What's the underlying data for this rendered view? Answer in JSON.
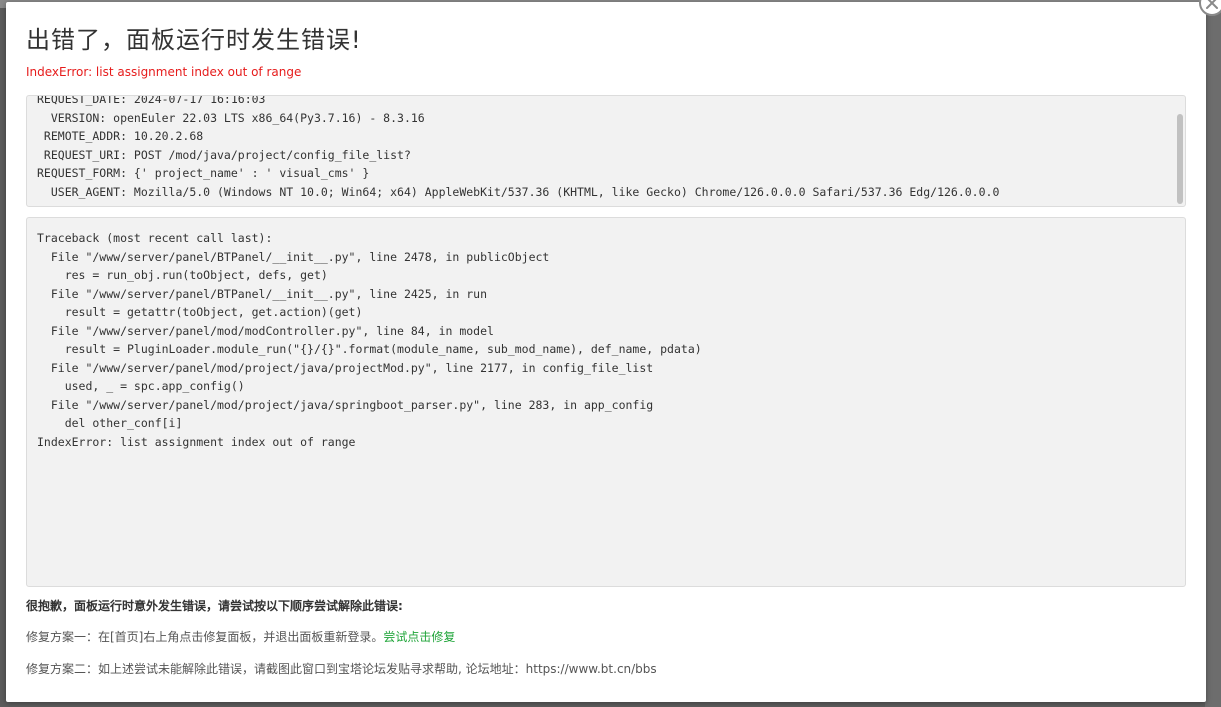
{
  "dialog": {
    "title": "出错了，面板运行时发生错误!",
    "error_summary": "IndexError: list assignment index out of range"
  },
  "request_info": [
    "REQUEST_DATE: 2024-07-17 16:16:03",
    "  VERSION: openEuler 22.03 LTS x86_64(Py3.7.16) - 8.3.16",
    " REMOTE_ADDR: 10.20.2.68",
    " REQUEST_URI: POST /mod/java/project/config_file_list?",
    "REQUEST_FORM: {' project_name' : ' visual_cms' }",
    "  USER_AGENT: Mozilla/5.0 (Windows NT 10.0; Win64; x64) AppleWebKit/537.36 (KHTML, like Gecko) Chrome/126.0.0.0 Safari/537.36 Edg/126.0.0.0"
  ],
  "traceback": [
    "Traceback (most recent call last):",
    "  File \"/www/server/panel/BTPanel/__init__.py\", line 2478, in publicObject",
    "    res = run_obj.run(toObject, defs, get)",
    "  File \"/www/server/panel/BTPanel/__init__.py\", line 2425, in run",
    "    result = getattr(toObject, get.action)(get)",
    "  File \"/www/server/panel/mod/modController.py\", line 84, in model",
    "    result = PluginLoader.module_run(\"{}/{}\".format(module_name, sub_mod_name), def_name, pdata)",
    "  File \"/www/server/panel/mod/project/java/projectMod.py\", line 2177, in config_file_list",
    "    used, _ = spc.app_config()",
    "  File \"/www/server/panel/mod/project/java/springboot_parser.py\", line 283, in app_config",
    "    del other_conf[i]",
    "IndexError: list assignment index out of range"
  ],
  "help": {
    "intro": "很抱歉，面板运行时意外发生错误，请尝试按以下顺序尝试解除此错误:",
    "solution1_text": "修复方案一：在[首页]右上角点击修复面板，并退出面板重新登录。",
    "solution1_link": "尝试点击修复",
    "solution2_text": "修复方案二：如上述尝试未能解除此错误，请截图此窗口到宝塔论坛发贴寻求帮助, 论坛地址：https://www.bt.cn/bbs"
  },
  "icons": {
    "close": "close-icon"
  },
  "colors": {
    "error": "#e61c1c",
    "link": "#20a53a"
  }
}
